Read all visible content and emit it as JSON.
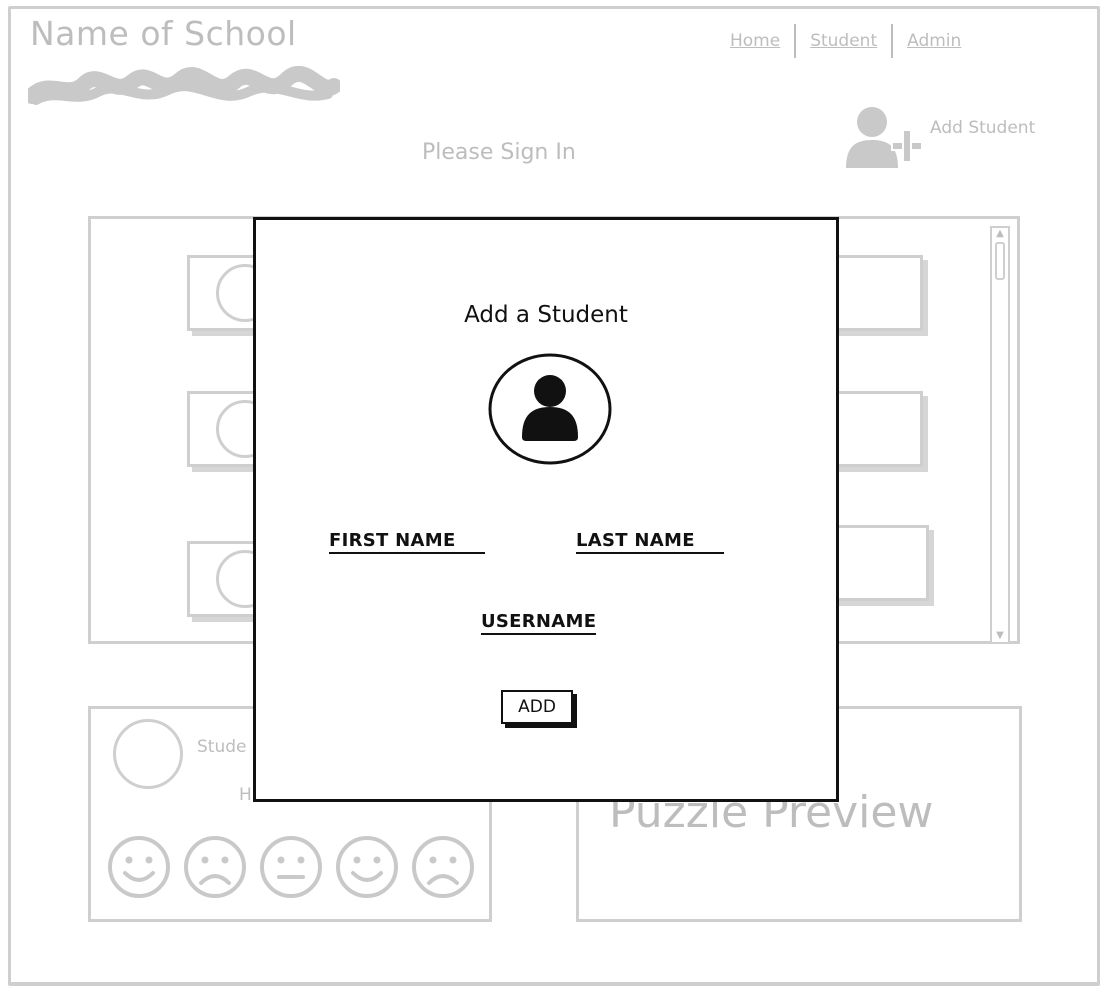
{
  "header": {
    "school_name": "Name of School"
  },
  "nav": {
    "home": "Home",
    "student": "Student",
    "admin": "Admin"
  },
  "toolbar": {
    "add_student_label": "Add Student",
    "add_student_icon": "add-user-icon"
  },
  "main": {
    "sign_in_label": "Please Sign In"
  },
  "student_panel": {
    "name_label": "Stude",
    "hint_label": "H",
    "faces": [
      "smile",
      "frown",
      "neutral",
      "smile",
      "frown"
    ]
  },
  "puzzle_panel": {
    "title": "Puzzle Preview"
  },
  "modal": {
    "title": "Add a Student",
    "avatar_icon": "user-icon",
    "first_name_label": "FIRST NAME",
    "last_name_label": "LAST NAME",
    "username_label": "USERNAME",
    "add_button_label": "ADD"
  },
  "colors": {
    "muted": "#bdbdbd",
    "border": "#cfcfcf",
    "ink": "#111111"
  }
}
